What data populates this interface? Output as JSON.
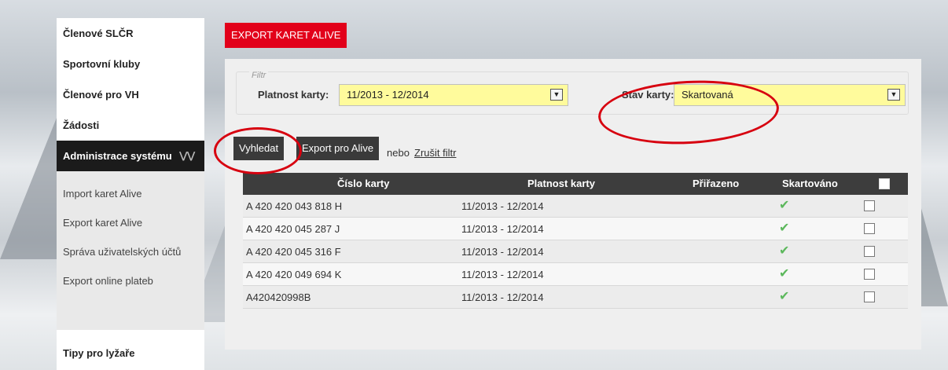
{
  "sidebar": {
    "items": [
      {
        "label": "Členové SLČR"
      },
      {
        "label": "Sportovní kluby"
      },
      {
        "label": "Členové pro VH"
      },
      {
        "label": "Žádosti"
      }
    ],
    "active": {
      "label": "Administrace systému",
      "chevron": "»"
    },
    "submenu": [
      {
        "label": "Import karet Alive"
      },
      {
        "label": "Export karet Alive"
      },
      {
        "label": "Správa uživatelských účtů"
      },
      {
        "label": "Export online plateb"
      }
    ],
    "bottom": {
      "label": "Tipy pro lyžaře"
    }
  },
  "header": {
    "title": "EXPORT KARET ALIVE"
  },
  "filter": {
    "legend": "Filtr",
    "validity_label": "Platnost karty:",
    "validity_value": "11/2013 - 12/2014",
    "state_label": "Stav karty:",
    "state_value": "Skartovaná"
  },
  "actions": {
    "search": "Vyhledat",
    "export": "Export pro Alive",
    "nebo": "nebo",
    "cancel": "Zrušit filtr"
  },
  "table": {
    "columns": [
      "Číslo karty",
      "Platnost karty",
      "Přiřazeno",
      "Skartováno"
    ],
    "rows": [
      {
        "card": "A 420 420 043 818 H",
        "validity": "11/2013 - 12/2014",
        "assigned": "",
        "shredded": true
      },
      {
        "card": "A 420 420 045 287 J",
        "validity": "11/2013 - 12/2014",
        "assigned": "",
        "shredded": true
      },
      {
        "card": "A 420 420 045 316 F",
        "validity": "11/2013 - 12/2014",
        "assigned": "",
        "shredded": true
      },
      {
        "card": "A 420 420 049 694 K",
        "validity": "11/2013 - 12/2014",
        "assigned": "",
        "shredded": true
      },
      {
        "card": "A420420998B",
        "validity": "11/2013 - 12/2014",
        "assigned": "",
        "shredded": true
      }
    ]
  },
  "colors": {
    "accent_red": "#e2001a",
    "select_yellow": "#fffb9c",
    "dark": "#3a3a3a",
    "check_green": "#5cb85c",
    "annotation_red": "#d7000f"
  },
  "icons": {
    "dropdown": "chevron-down-icon",
    "check": "checkmark-icon"
  }
}
